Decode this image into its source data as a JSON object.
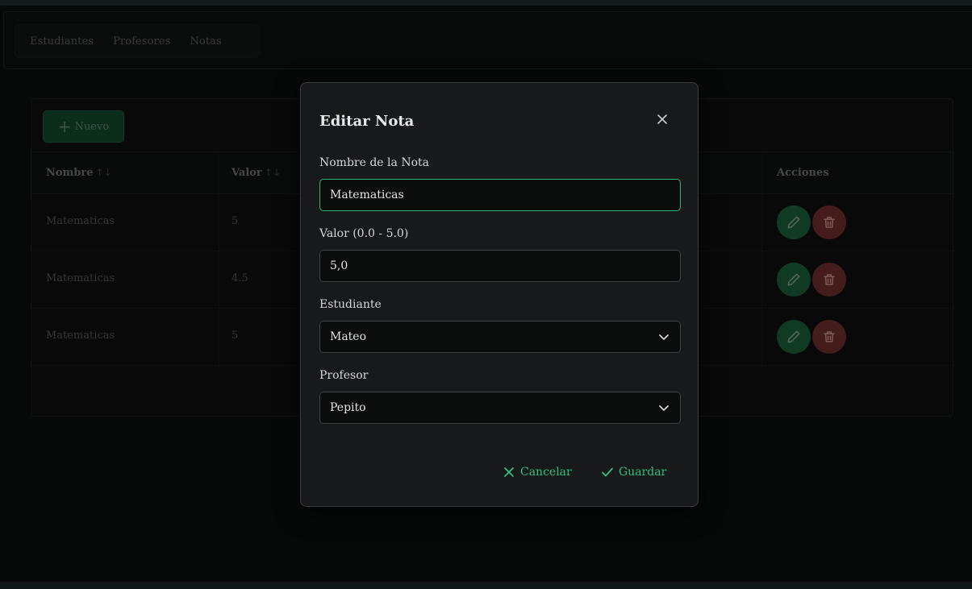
{
  "nav": {
    "items": [
      "Estudiantes",
      "Profesores",
      "Notas"
    ]
  },
  "toolbar": {
    "new_label": "Nuevo",
    "new_icon": "plus-icon"
  },
  "table": {
    "columns": [
      {
        "label": "Nombre",
        "sortable": true
      },
      {
        "label": "Valor",
        "sortable": true
      },
      {
        "label": "Acciones",
        "sortable": false
      }
    ],
    "sort_icon": "↑↓",
    "rows": [
      {
        "nombre": "Matematicas",
        "valor": "5"
      },
      {
        "nombre": "Matematicas",
        "valor": "4.5"
      },
      {
        "nombre": "Matematicas",
        "valor": "5"
      }
    ],
    "actions": {
      "edit_icon": "pencil-icon",
      "delete_icon": "trash-icon"
    }
  },
  "dialog": {
    "title": "Editar Nota",
    "close_icon": "close-icon",
    "fields": {
      "nombre": {
        "label": "Nombre de la Nota",
        "value": "Matematicas"
      },
      "valor": {
        "label": "Valor (0.0 - 5.0)",
        "value": "5,0"
      },
      "estudiante": {
        "label": "Estudiante",
        "value": "Mateo"
      },
      "profesor": {
        "label": "Profesor",
        "value": "Pepito"
      }
    },
    "cancel_label": "Cancelar",
    "save_label": "Guardar"
  },
  "colors": {
    "accent": "#2fc082",
    "edit": "#1b5a3a",
    "delete": "#6a2c2c",
    "background": "#0c0d0d",
    "dialog": "#18191a"
  }
}
